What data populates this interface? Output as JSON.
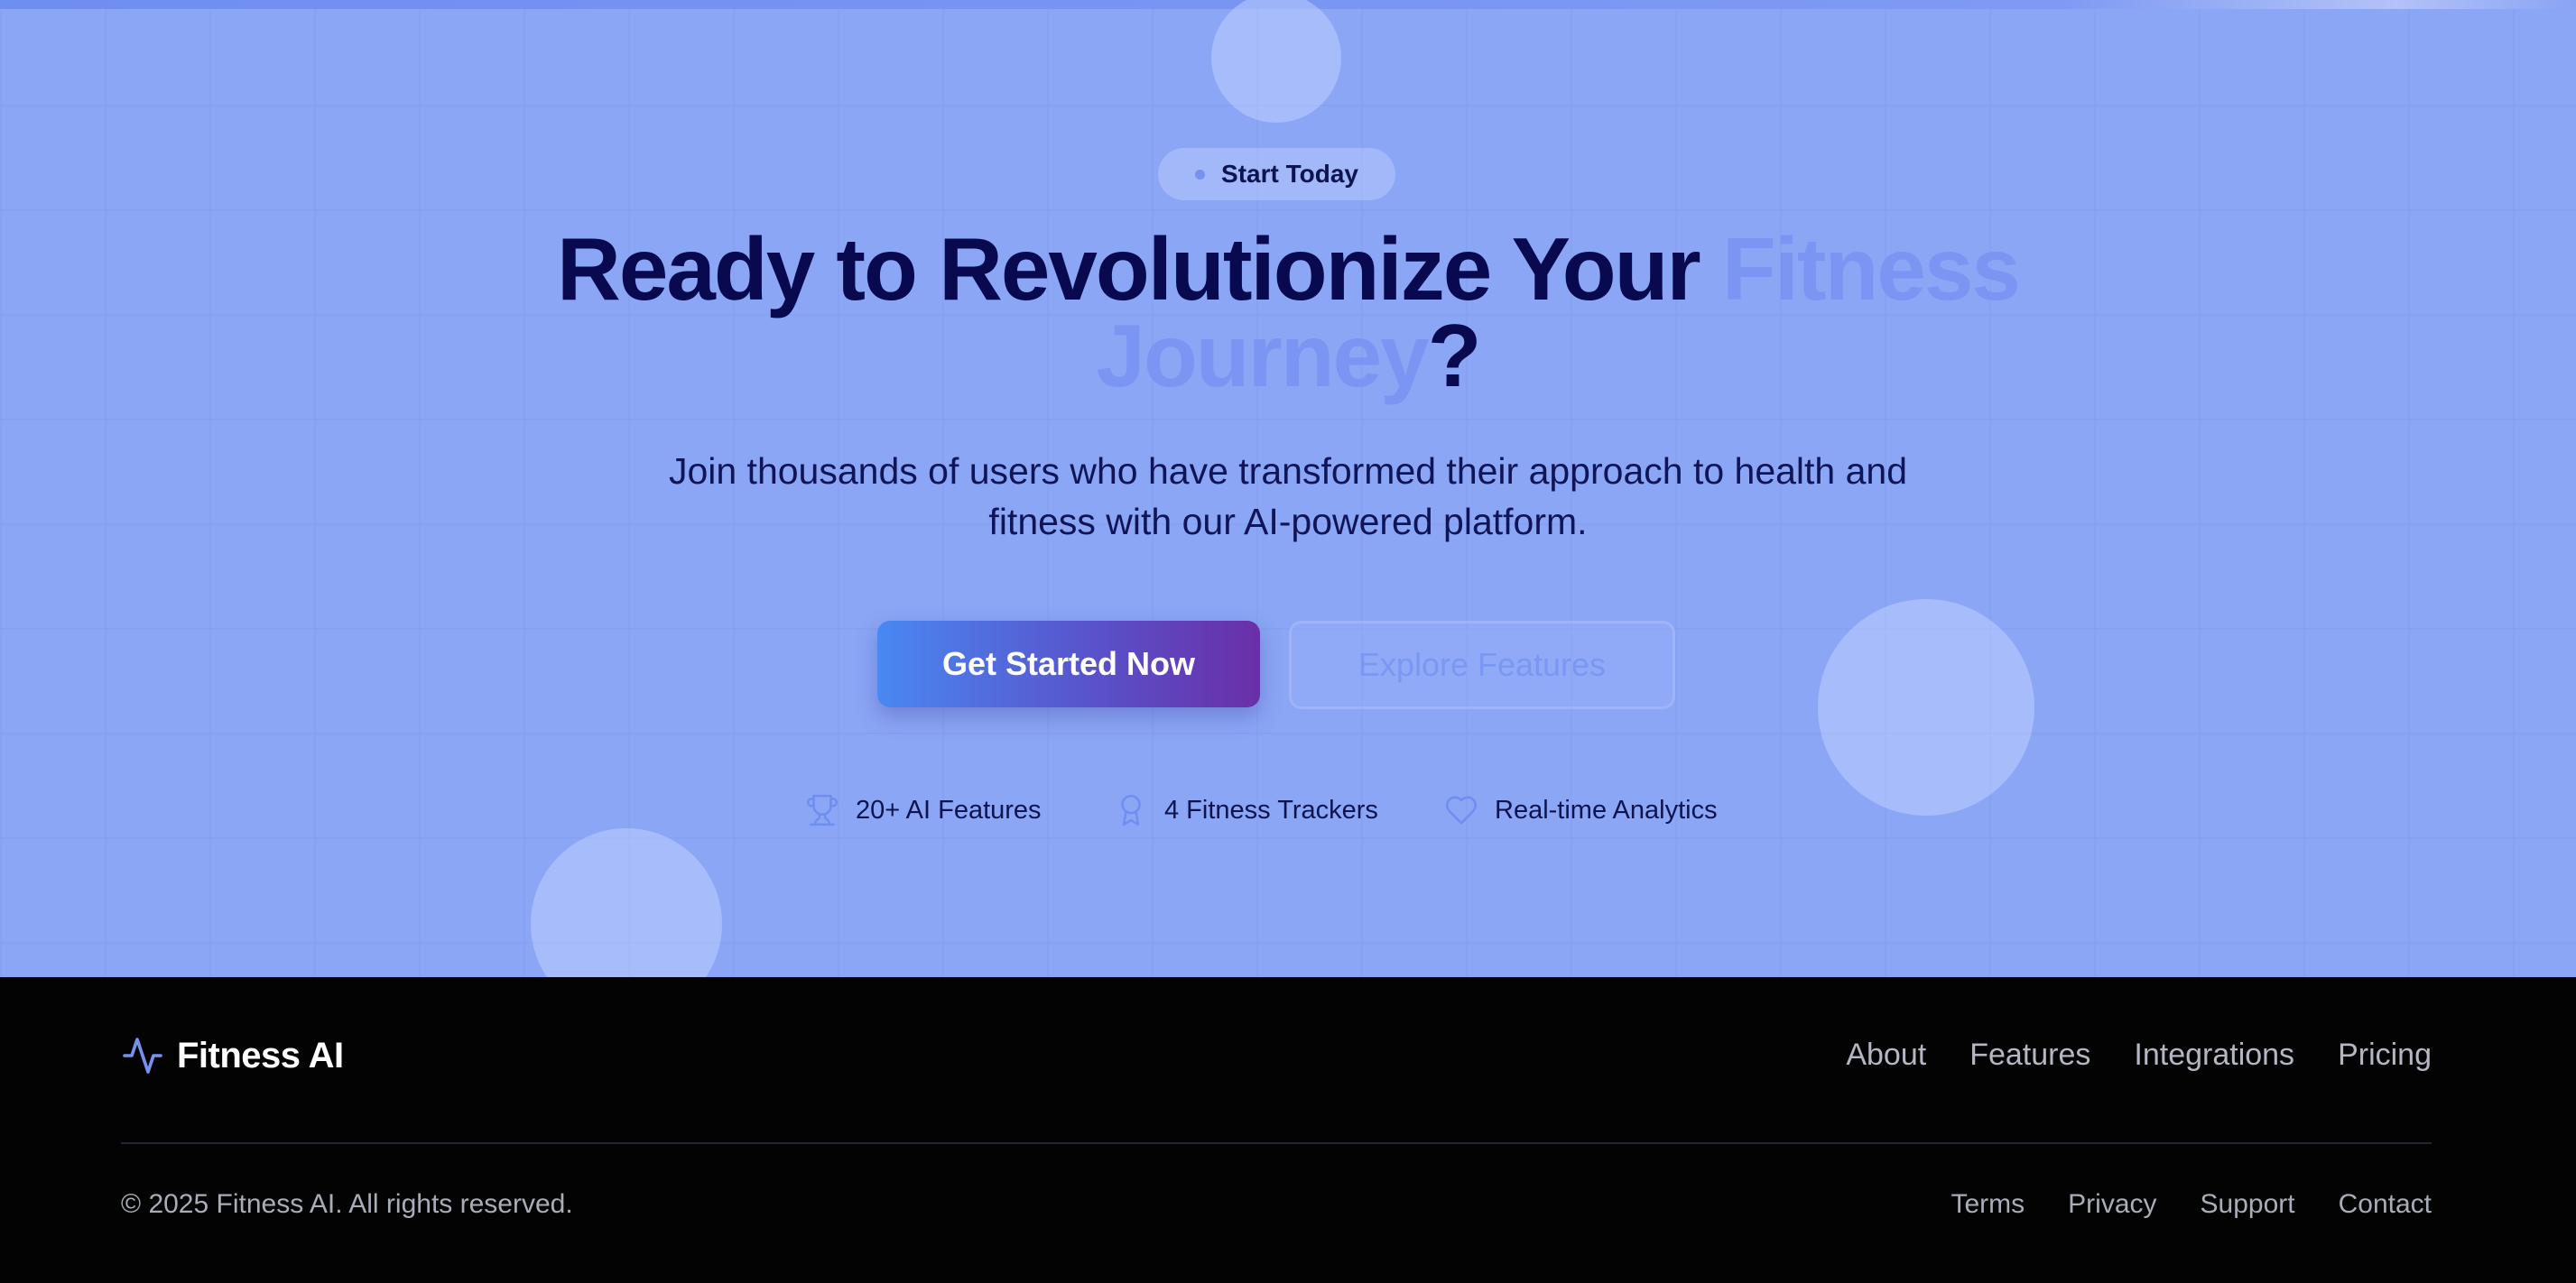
{
  "hero": {
    "badge": {
      "label": "Start Today"
    },
    "headline": {
      "part1": "Ready to Revolutionize Your ",
      "accent": "Fitness Journey",
      "end": "?"
    },
    "subtext": "Join thousands of users who have transformed their approach to health and fitness with our AI-powered platform.",
    "buttons": {
      "primary": "Get Started Now",
      "secondary": "Explore Features"
    },
    "stats": [
      {
        "icon": "trophy-icon",
        "label": "20+ AI Features"
      },
      {
        "icon": "award-icon",
        "label": "4 Fitness Trackers"
      },
      {
        "icon": "heart-icon",
        "label": "Real-time Analytics"
      }
    ]
  },
  "footer": {
    "brand": {
      "icon": "activity-pulse-icon",
      "name": "Fitness AI"
    },
    "nav": [
      "About",
      "Features",
      "Integrations",
      "Pricing"
    ],
    "copyright": "© 2025 Fitness AI. All rights reserved.",
    "legal": [
      "Terms",
      "Privacy",
      "Support",
      "Contact"
    ]
  },
  "colors": {
    "hero_bg": "#8ba6f5",
    "headline": "#08094f",
    "accent": "#7a96f2",
    "button_gradient_start": "#4a88f2",
    "button_gradient_end": "#6a2fa8",
    "footer_bg": "#030303"
  }
}
